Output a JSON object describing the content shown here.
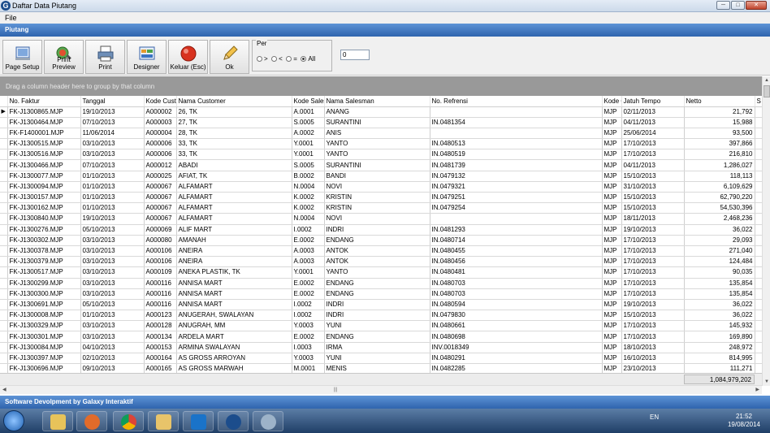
{
  "window": {
    "title": "Daftar Data Piutang",
    "app_icon_letter": "G"
  },
  "menu": {
    "file": "File"
  },
  "panel_title": "Piutang",
  "toolbar": {
    "page_setup": "Page Setup",
    "print_preview": "Print Preview",
    "print": "Print",
    "designer": "Designer",
    "keluar": "Keluar (Esc)",
    "ok": "Ok"
  },
  "per": {
    "label": "Per",
    "options": [
      ">",
      "<",
      "=",
      "All"
    ],
    "selected": "All",
    "value": "0"
  },
  "group_hint": "Drag a column header here to group by that column",
  "columns": [
    "No. Faktur",
    "Tanggal",
    "Kode Custo",
    "Nama Customer",
    "Kode Salesm",
    "Nama Salesman",
    "No. Refrensi",
    "Kode C",
    "Jatuh Tempo",
    "Netto",
    "S"
  ],
  "rows": [
    [
      "FK-J1300865.MJP",
      "19/10/2013",
      "A000002",
      "26, TK",
      "A.0001",
      "ANANG",
      "",
      "MJP",
      "02/11/2013",
      "21,792"
    ],
    [
      "FK-J1300464.MJP",
      "07/10/2013",
      "A000003",
      "27, TK",
      "S.0005",
      "SURANTINI",
      "IN.0481354",
      "MJP",
      "04/11/2013",
      "15,988"
    ],
    [
      "FK-F1400001.MJP",
      "11/06/2014",
      "A000004",
      "28, TK",
      "A.0002",
      "ANIS",
      "",
      "MJP",
      "25/06/2014",
      "93,500"
    ],
    [
      "FK-J1300515.MJP",
      "03/10/2013",
      "A000006",
      "33, TK",
      "Y.0001",
      "YANTO",
      "IN.0480513",
      "MJP",
      "17/10/2013",
      "397,866"
    ],
    [
      "FK-J1300516.MJP",
      "03/10/2013",
      "A000006",
      "33, TK",
      "Y.0001",
      "YANTO",
      "IN.0480519",
      "MJP",
      "17/10/2013",
      "216,810"
    ],
    [
      "FK-J1300466.MJP",
      "07/10/2013",
      "A000012",
      "ABADI",
      "S.0005",
      "SURANTINI",
      "IN.0481739",
      "MJP",
      "04/11/2013",
      "1,286,027"
    ],
    [
      "FK-J1300077.MJP",
      "01/10/2013",
      "A000025",
      "AFIAT, TK",
      "B.0002",
      "BANDI",
      "IN.0479132",
      "MJP",
      "15/10/2013",
      "118,113"
    ],
    [
      "FK-J1300094.MJP",
      "01/10/2013",
      "A000067",
      "ALFAMART",
      "N.0004",
      "NOVI",
      "IN.0479321",
      "MJP",
      "31/10/2013",
      "6,109,629"
    ],
    [
      "FK-J1300157.MJP",
      "01/10/2013",
      "A000067",
      "ALFAMART",
      "K.0002",
      "KRISTIN",
      "IN.0479251",
      "MJP",
      "15/10/2013",
      "62,790,220"
    ],
    [
      "FK-J1300162.MJP",
      "01/10/2013",
      "A000067",
      "ALFAMART",
      "K.0002",
      "KRISTIN",
      "IN.0479254",
      "MJP",
      "15/10/2013",
      "54,530,396"
    ],
    [
      "FK-J1300840.MJP",
      "19/10/2013",
      "A000067",
      "ALFAMART",
      "N.0004",
      "NOVI",
      "",
      "MJP",
      "18/11/2013",
      "2,468,236"
    ],
    [
      "FK-J1300276.MJP",
      "05/10/2013",
      "A000069",
      "ALIF MART",
      "I.0002",
      "INDRI",
      "IN.0481293",
      "MJP",
      "19/10/2013",
      "36,022"
    ],
    [
      "FK-J1300302.MJP",
      "03/10/2013",
      "A000080",
      "AMANAH",
      "E.0002",
      "ENDANG",
      "IN.0480714",
      "MJP",
      "17/10/2013",
      "29,093"
    ],
    [
      "FK-J1300378.MJP",
      "03/10/2013",
      "A000106",
      "ANEIRA",
      "A.0003",
      "ANTOK",
      "IN.0480455",
      "MJP",
      "17/10/2013",
      "271,040"
    ],
    [
      "FK-J1300379.MJP",
      "03/10/2013",
      "A000106",
      "ANEIRA",
      "A.0003",
      "ANTOK",
      "IN.0480456",
      "MJP",
      "17/10/2013",
      "124,484"
    ],
    [
      "FK-J1300517.MJP",
      "03/10/2013",
      "A000109",
      "ANEKA PLASTIK, TK",
      "Y.0001",
      "YANTO",
      "IN.0480481",
      "MJP",
      "17/10/2013",
      "90,035"
    ],
    [
      "FK-J1300299.MJP",
      "03/10/2013",
      "A000116",
      "ANNISA MART",
      "E.0002",
      "ENDANG",
      "IN.0480703",
      "MJP",
      "17/10/2013",
      "135,854"
    ],
    [
      "FK-J1300300.MJP",
      "03/10/2013",
      "A000116",
      "ANNISA MART",
      "E.0002",
      "ENDANG",
      "IN.0480703",
      "MJP",
      "17/10/2013",
      "135,854"
    ],
    [
      "FK-J1300691.MJP",
      "05/10/2013",
      "A000116",
      "ANNISA MART",
      "I.0002",
      "INDRI",
      "IN.0480594",
      "MJP",
      "19/10/2013",
      "36,022"
    ],
    [
      "FK-J1300008.MJP",
      "01/10/2013",
      "A000123",
      "ANUGERAH, SWALAYAN",
      "I.0002",
      "INDRI",
      "IN.0479830",
      "MJP",
      "15/10/2013",
      "36,022"
    ],
    [
      "FK-J1300329.MJP",
      "03/10/2013",
      "A000128",
      "ANUGRAH, MM",
      "Y.0003",
      "YUNI",
      "IN.0480661",
      "MJP",
      "17/10/2013",
      "145,932"
    ],
    [
      "FK-J1300301.MJP",
      "03/10/2013",
      "A000134",
      "ARDELA MART",
      "E.0002",
      "ENDANG",
      "IN.0480698",
      "MJP",
      "17/10/2013",
      "169,890"
    ],
    [
      "FK-J1300084.MJP",
      "04/10/2013",
      "A000153",
      "ARMINA SWALAYAN",
      "I.0003",
      "IRMA",
      "INV.0018349",
      "MJP",
      "18/10/2013",
      "248,972"
    ],
    [
      "FK-J1300397.MJP",
      "02/10/2013",
      "A000164",
      "AS GROSS ARROYAN",
      "Y.0003",
      "YUNI",
      "IN.0480291",
      "MJP",
      "16/10/2013",
      "814,995"
    ],
    [
      "FK-J1300696.MJP",
      "09/10/2013",
      "A000165",
      "AS GROSS MARWAH",
      "M.0001",
      "MENIS",
      "IN.0482285",
      "MJP",
      "23/10/2013",
      "111,271"
    ]
  ],
  "total_netto": "1,084,979,202",
  "status_text": "Software Devolpment by Galaxy Interaktif",
  "taskbar": {
    "language": "EN",
    "time": "21:52",
    "date": "19/08/2014"
  }
}
